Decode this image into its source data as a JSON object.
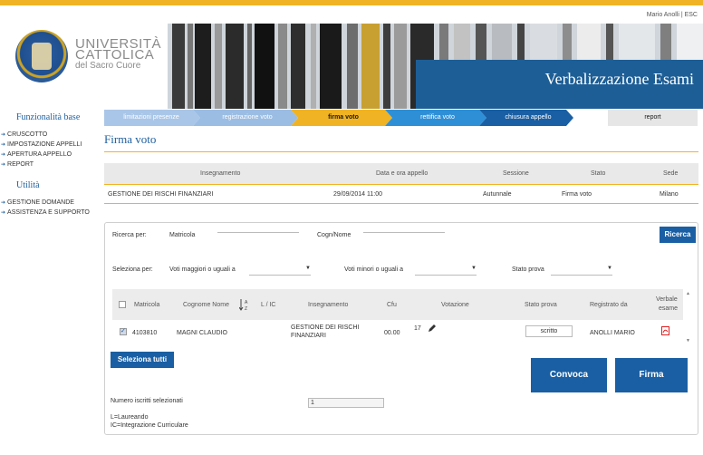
{
  "header": {
    "user_info": "Mario Anolli | ESC",
    "university_name": [
      "UNIVERSITÀ",
      "CATTOLICA",
      "del Sacro Cuore"
    ],
    "app_title": "Verbalizzazione Esami"
  },
  "sidebar": {
    "section1_title": "Funzionalità base",
    "section1_items": [
      "CRUSCOTTO",
      "IMPOSTAZIONE APPELLI",
      "APERTURA APPELLO",
      "REPORT"
    ],
    "section2_title": "Utilità",
    "section2_items": [
      "GESTIONE DOMANDE",
      "ASSISTENZA E SUPPORTO"
    ]
  },
  "steps": [
    {
      "label": "limitazioni presenze",
      "color": "#a9c6e8"
    },
    {
      "label": "registrazione voto",
      "color": "#9bbde3"
    },
    {
      "label": "firma voto",
      "color": "#f0b323",
      "text_color": "#1a1a1a",
      "active": true
    },
    {
      "label": "rettifica voto",
      "color": "#2f8fd6"
    },
    {
      "label": "chiusura appello",
      "color": "#1a5fa3"
    },
    {
      "label": "report",
      "color": "#e6e6e6",
      "text_color": "#1a1a1a"
    }
  ],
  "page": {
    "title": "Firma voto"
  },
  "insegnamento_table": {
    "headers": [
      "Insegnamento",
      "Data e ora appello",
      "Sessione",
      "Stato",
      "Sede"
    ],
    "row": [
      "GESTIONE DEI RISCHI FINANZIARI",
      "29/09/2014 11:00",
      "Autunnale",
      "Firma voto",
      "Milano"
    ]
  },
  "search": {
    "ricerca_per": "Ricerca per:",
    "matricola": "Matricola",
    "cognome_nome": "Cogn/Nome",
    "ricerca_button": "Ricerca",
    "seleziona_per": "Seleziona per:",
    "voti_maggiori": "Voti maggiori o uguali a",
    "voti_minori": "Voti minori o uguali a",
    "stato_prova": "Stato prova"
  },
  "grid": {
    "headers": {
      "matricola": "Matricola",
      "cognome_nome": "Cognome Nome",
      "sort_icon": "sort-az-icon",
      "l_ic": "L / IC",
      "insegnamento": "Insegnamento",
      "cfu": "Cfu",
      "votazione": "Votazione",
      "stato_prova": "Stato prova",
      "registrato_da": "Registrato da",
      "verbale_esame": [
        "Verbale",
        "esame"
      ]
    },
    "rows": [
      {
        "checked": true,
        "matricola": "4103810",
        "cognome_nome": "MAGNI CLAUDIO",
        "insegnamento": [
          "GESTIONE DEI RISCHI",
          "FINANZIARI"
        ],
        "cfu": "00.00",
        "votazione": "17",
        "stato_prova": "scritto",
        "registrato_da": "ANOLLI MARIO",
        "verbale_icon": "pdf-icon"
      }
    ]
  },
  "actions": {
    "seleziona_tutti": "Seleziona tutti",
    "convoca": "Convoca",
    "firma": "Firma"
  },
  "footer": {
    "numero_label": "Numero iscritti selezionati",
    "numero_value": "1",
    "legend_l": "L=Laureando",
    "legend_ic": "IC=Integrazione Curriculare"
  }
}
